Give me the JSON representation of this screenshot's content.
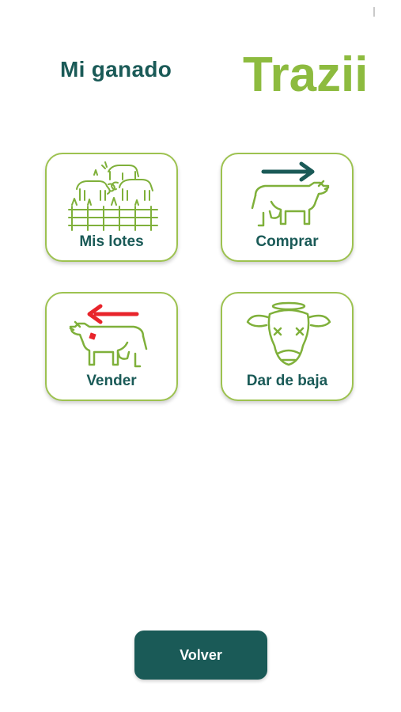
{
  "header": {
    "title": "Mi ganado",
    "logo_text": "Trazii"
  },
  "menu": {
    "items": [
      {
        "label": "Mis lotes",
        "icon": "herd-fence-icon"
      },
      {
        "label": "Comprar",
        "icon": "cow-arrow-right-icon"
      },
      {
        "label": "Vender",
        "icon": "cow-arrow-left-icon"
      },
      {
        "label": "Dar de baja",
        "icon": "dead-cow-icon"
      }
    ]
  },
  "footer": {
    "back_label": "Volver"
  },
  "colors": {
    "brand_dark": "#1a5a57",
    "brand_green": "#8dbb3f",
    "tile_border": "#9dc250",
    "sell_arrow": "#e8242b",
    "buy_arrow": "#1a5a57"
  }
}
